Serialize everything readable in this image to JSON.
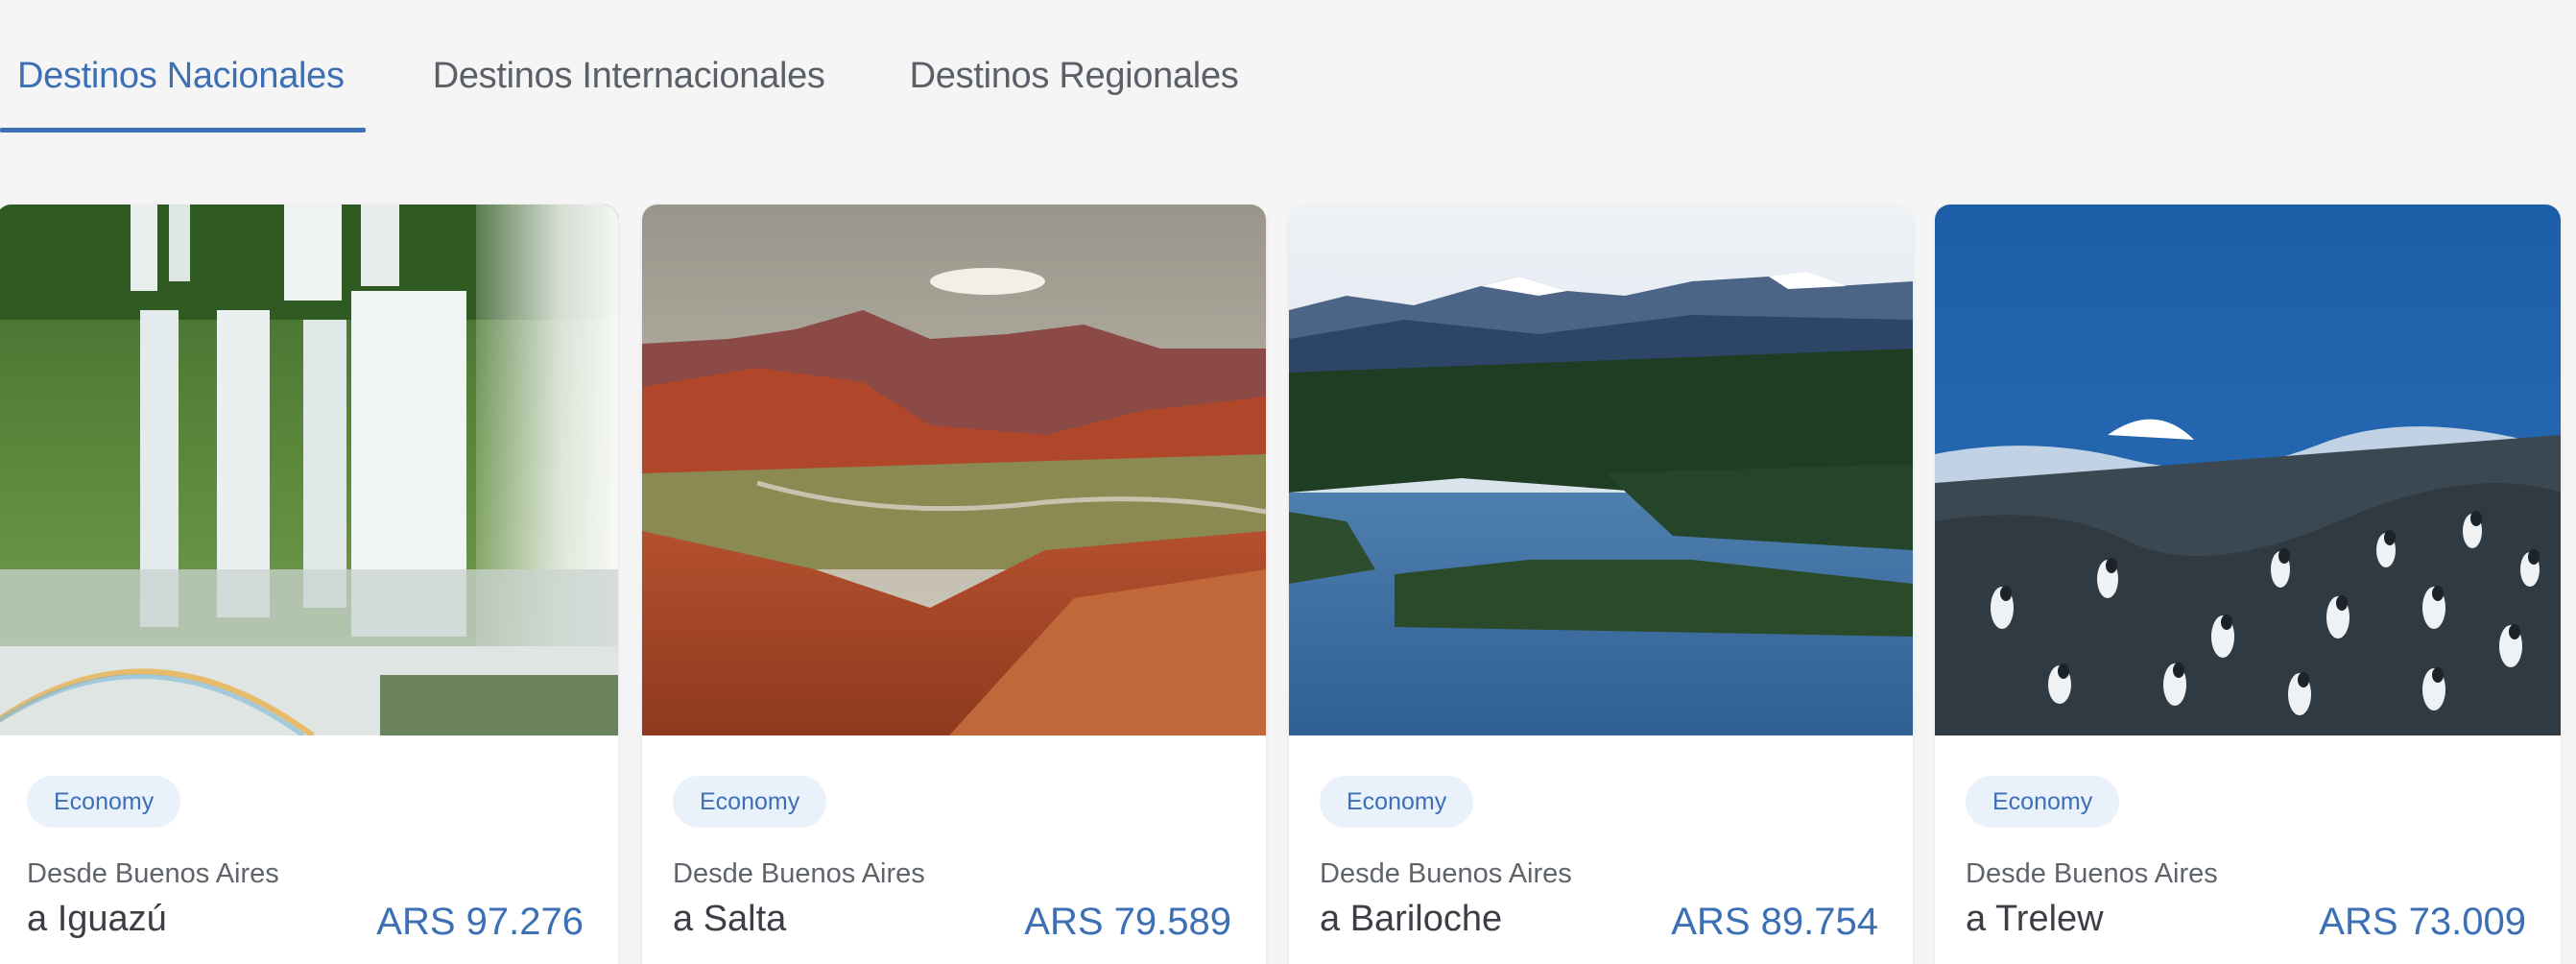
{
  "tabs": [
    {
      "label": "Destinos Nacionales",
      "active": true
    },
    {
      "label": "Destinos Internacionales",
      "active": false
    },
    {
      "label": "Destinos Regionales",
      "active": false
    }
  ],
  "cards": [
    {
      "badge": "Economy",
      "origin": "Desde Buenos Aires",
      "destination": "a Iguazú",
      "price": "ARS 97.276",
      "image": "waterfall-photo"
    },
    {
      "badge": "Economy",
      "origin": "Desde Buenos Aires",
      "destination": "a Salta",
      "price": "ARS 79.589",
      "image": "red-mountains-photo"
    },
    {
      "badge": "Economy",
      "origin": "Desde Buenos Aires",
      "destination": "a Bariloche",
      "price": "ARS 89.754",
      "image": "lake-forest-photo"
    },
    {
      "badge": "Economy",
      "origin": "Desde Buenos Aires",
      "destination": "a Trelew",
      "price": "ARS 73.009",
      "image": "penguins-coast-photo"
    }
  ],
  "colors": {
    "accent": "#3d6fb5",
    "badge_bg": "#e9f1fb",
    "page_bg": "#f5f5f5"
  }
}
